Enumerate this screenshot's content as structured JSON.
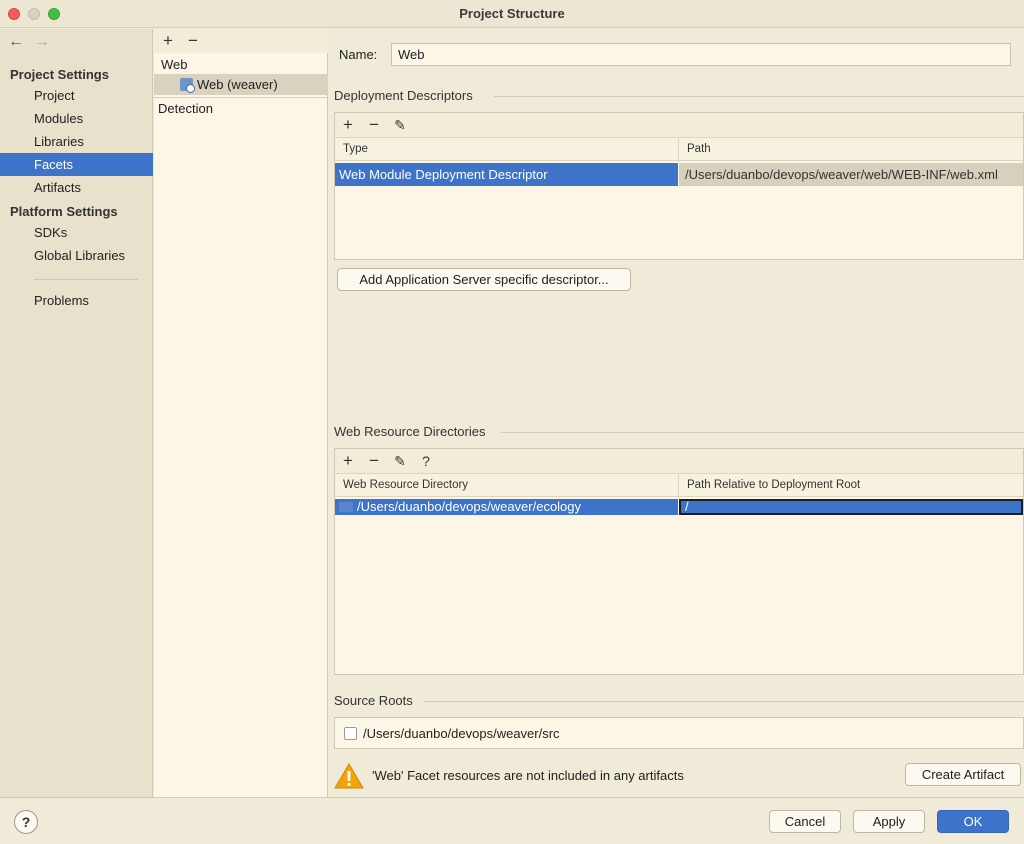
{
  "window": {
    "title": "Project Structure"
  },
  "sidebar": {
    "back_icon": "←",
    "forward_icon": "→",
    "project_settings_header": "Project Settings",
    "project_items": [
      {
        "label": "Project"
      },
      {
        "label": "Modules"
      },
      {
        "label": "Libraries"
      },
      {
        "label": "Facets",
        "selected": true
      },
      {
        "label": "Artifacts"
      }
    ],
    "platform_settings_header": "Platform Settings",
    "platform_items": [
      {
        "label": "SDKs"
      },
      {
        "label": "Global Libraries"
      }
    ],
    "problems_label": "Problems"
  },
  "facets": {
    "add_icon": "+",
    "remove_icon": "−",
    "group_label": "Web",
    "item_label": "Web (weaver)",
    "detection_label": "Detection"
  },
  "main": {
    "name_label": "Name:",
    "name_value": "Web",
    "deployment": {
      "title": "Deployment Descriptors",
      "columns": [
        "Type",
        "Path"
      ],
      "rows": [
        {
          "type": "Web Module Deployment Descriptor",
          "path": "/Users/duanbo/devops/weaver/web/WEB-INF/web.xml"
        }
      ],
      "add_server_button": "Add Application Server specific descriptor..."
    },
    "resources": {
      "title": "Web Resource Directories",
      "columns": [
        "Web Resource Directory",
        "Path Relative to Deployment Root"
      ],
      "rows": [
        {
          "directory": "/Users/duanbo/devops/weaver/ecology",
          "relative_path": "/"
        }
      ]
    },
    "source_roots": {
      "title": "Source Roots",
      "items": [
        {
          "path": "/Users/duanbo/devops/weaver/src",
          "checked": false
        }
      ]
    },
    "warning_text": "'Web' Facet resources are not included in any artifacts",
    "create_artifact_button": "Create Artifact"
  },
  "footer": {
    "help_label": "?",
    "cancel_button": "Cancel",
    "apply_button": "Apply",
    "ok_button": "OK"
  },
  "colors": {
    "selection": "#3d73c8",
    "background": "#f0ead8",
    "panel": "#fcf6e6",
    "sidebar": "#e8e1cc"
  }
}
